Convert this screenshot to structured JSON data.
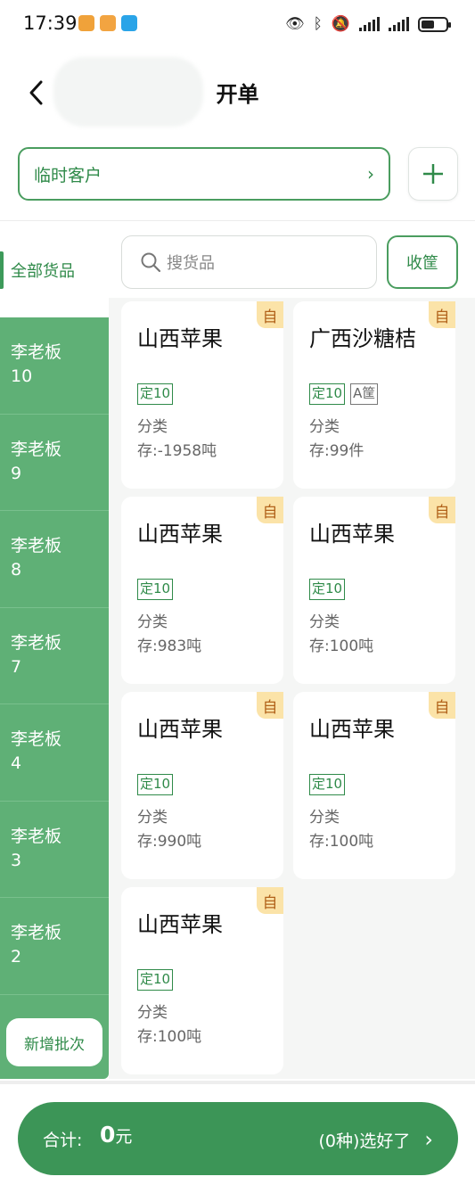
{
  "status_bar": {
    "time": "17:39",
    "app_icon_colors": [
      "#f0a23a",
      "#f2a441",
      "#2aa4e8"
    ],
    "battery_level": 0.55
  },
  "header": {
    "title": "开单",
    "back_icon": "chevron-left-icon"
  },
  "customer": {
    "label": "临时客户",
    "chevron": "›",
    "add_icon": "plus-icon"
  },
  "sidebar": {
    "all_label": "全部货品",
    "items": [
      {
        "name": "李老板",
        "num": "10"
      },
      {
        "name": "李老板",
        "num": "9"
      },
      {
        "name": "李老板",
        "num": "8"
      },
      {
        "name": "李老板",
        "num": "7"
      },
      {
        "name": "李老板",
        "num": "4"
      },
      {
        "name": "李老板",
        "num": "3"
      },
      {
        "name": "李老板",
        "num": "2"
      }
    ],
    "new_batch_label": "新增批次"
  },
  "search": {
    "placeholder": "搜货品",
    "basket_label": "收筐"
  },
  "products": [
    {
      "name": "山西苹果",
      "badge": "自",
      "tag": "定10",
      "extra_tag": "",
      "category": "分类",
      "stock": "存:-1958吨"
    },
    {
      "name": "广西沙糖桔",
      "badge": "自",
      "tag": "定10",
      "extra_tag": "A筐",
      "category": "分类",
      "stock": "存:99件"
    },
    {
      "name": "山西苹果",
      "badge": "自",
      "tag": "定10",
      "extra_tag": "",
      "category": "分类",
      "stock": "存:983吨"
    },
    {
      "name": "山西苹果",
      "badge": "自",
      "tag": "定10",
      "extra_tag": "",
      "category": "分类",
      "stock": "存:100吨"
    },
    {
      "name": "山西苹果",
      "badge": "自",
      "tag": "定10",
      "extra_tag": "",
      "category": "分类",
      "stock": "存:990吨"
    },
    {
      "name": "山西苹果",
      "badge": "自",
      "tag": "定10",
      "extra_tag": "",
      "category": "分类",
      "stock": "存:100吨"
    },
    {
      "name": "山西苹果",
      "badge": "自",
      "tag": "定10",
      "extra_tag": "",
      "category": "分类",
      "stock": "存:100吨"
    }
  ],
  "footer": {
    "total_label": "合计:",
    "total_amount": "0",
    "total_unit": "元",
    "kinds_label": "(0种)选好了",
    "chevron": "›"
  },
  "colors": {
    "primary": "#3c9557",
    "sidebar_green": "#5fb076",
    "badge_bg": "#fbe3a8"
  }
}
